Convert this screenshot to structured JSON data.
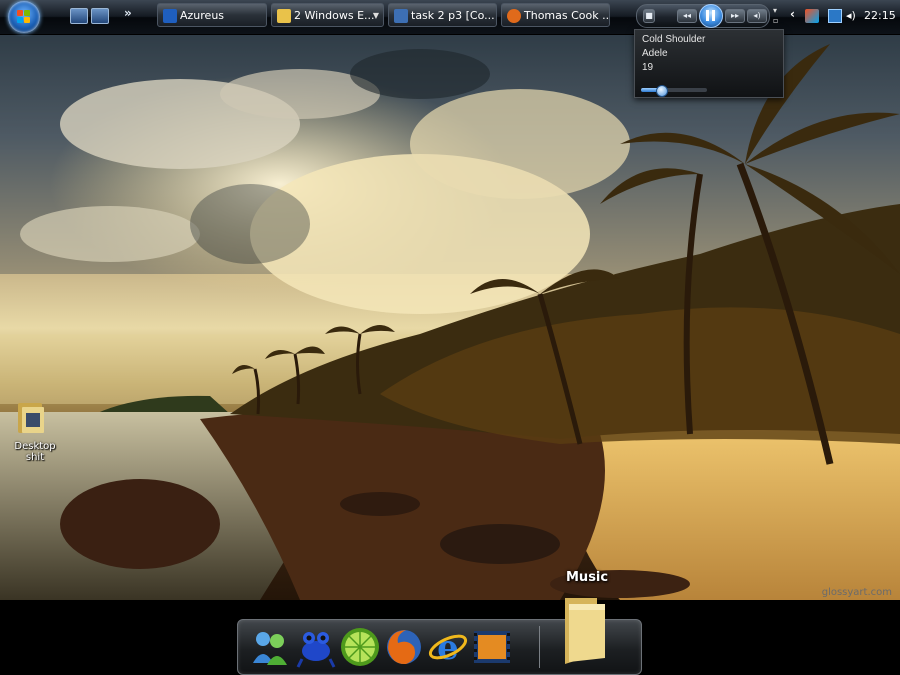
{
  "taskbar": {
    "start_button": "start-orb",
    "quick_launch": [
      "show-desktop-icon",
      "switch-windows-icon"
    ],
    "tasks": [
      {
        "label": "Azureus",
        "icon": "azureus-icon",
        "color": "#1f5fbf"
      },
      {
        "label": "2 Windows E...",
        "icon": "folder-icon",
        "color": "#e9c24a"
      },
      {
        "label": "task 2 p3 [Co...",
        "icon": "document-icon",
        "color": "#3d6fb3"
      },
      {
        "label": "Thomas Cook ...",
        "icon": "firefox-icon",
        "color": "#e06a1b"
      }
    ],
    "clock": "22:15"
  },
  "now_playing": {
    "title": "Cold Shoulder",
    "artist": "Adele",
    "track_number": "19",
    "progress": 0.3
  },
  "desktop": {
    "icons": [
      {
        "label": "Desktop shit",
        "icon": "folder-icon"
      }
    ],
    "watermark": "glossyart.com"
  },
  "dock": {
    "items": [
      {
        "name": "messenger-icon"
      },
      {
        "name": "frog-icon"
      },
      {
        "name": "limewire-icon"
      },
      {
        "name": "firefox-icon"
      },
      {
        "name": "internet-explorer-icon"
      },
      {
        "name": "media-player-icon"
      }
    ],
    "hover_label": "Music",
    "music_folder": "music-folder-icon"
  }
}
